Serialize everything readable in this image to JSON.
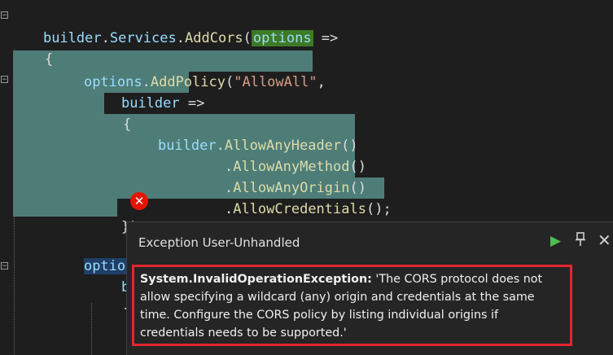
{
  "code": {
    "l1_builder": "builder",
    "l1_dot1": ".",
    "l1_services": "Services",
    "l1_dot2": ".",
    "l1_method": "AddCors",
    "l1_paren": "(",
    "l1_options": "options",
    "l1_arrow": " =>",
    "l2_brace": "{",
    "l3_options": "options",
    "l3_dot": ".",
    "l3_method": "AddPolicy",
    "l3_paren": "(",
    "l3_string": "\"AllowAll\"",
    "l3_comma": ",",
    "l4_builder": "builder",
    "l4_arrow": " =>",
    "l5_brace": "{",
    "l6_builder": "builder",
    "l6_dot": ".",
    "l6_method": "AllowAnyHeader",
    "l6_parens": "()",
    "l7_dot": ".",
    "l7_method": "AllowAnyMethod",
    "l7_parens": "()",
    "l8_dot": ".",
    "l8_method": "AllowAnyOrigin",
    "l8_parens": "()",
    "l9_dot": ".",
    "l9_method": "AllowCredentials",
    "l9_parens": "();",
    "l10_close": "});",
    "l11_options": "options",
    "l11_dot": ".",
    "l12_builder": "buil",
    "l13_brace": "{"
  },
  "popup": {
    "title": "Exception User-Unhandled",
    "exception_type": "System.InvalidOperationException:",
    "message_line1": " 'The CORS protocol does not",
    "message_line2": "allow specifying a wildcard (any) origin and credentials at the same",
    "message_line3": "time. Configure the CORS policy by listing individual origins if",
    "message_line4": "credentials needs to be supported.'",
    "continue_icon": "play-icon",
    "pin_icon": "pin-icon",
    "close_icon": "close-icon"
  },
  "colors": {
    "editor_bg": "#1e1e1e",
    "selection": "#4e7d78",
    "error_red": "#e3262f",
    "continue_green": "#4ec04e"
  }
}
